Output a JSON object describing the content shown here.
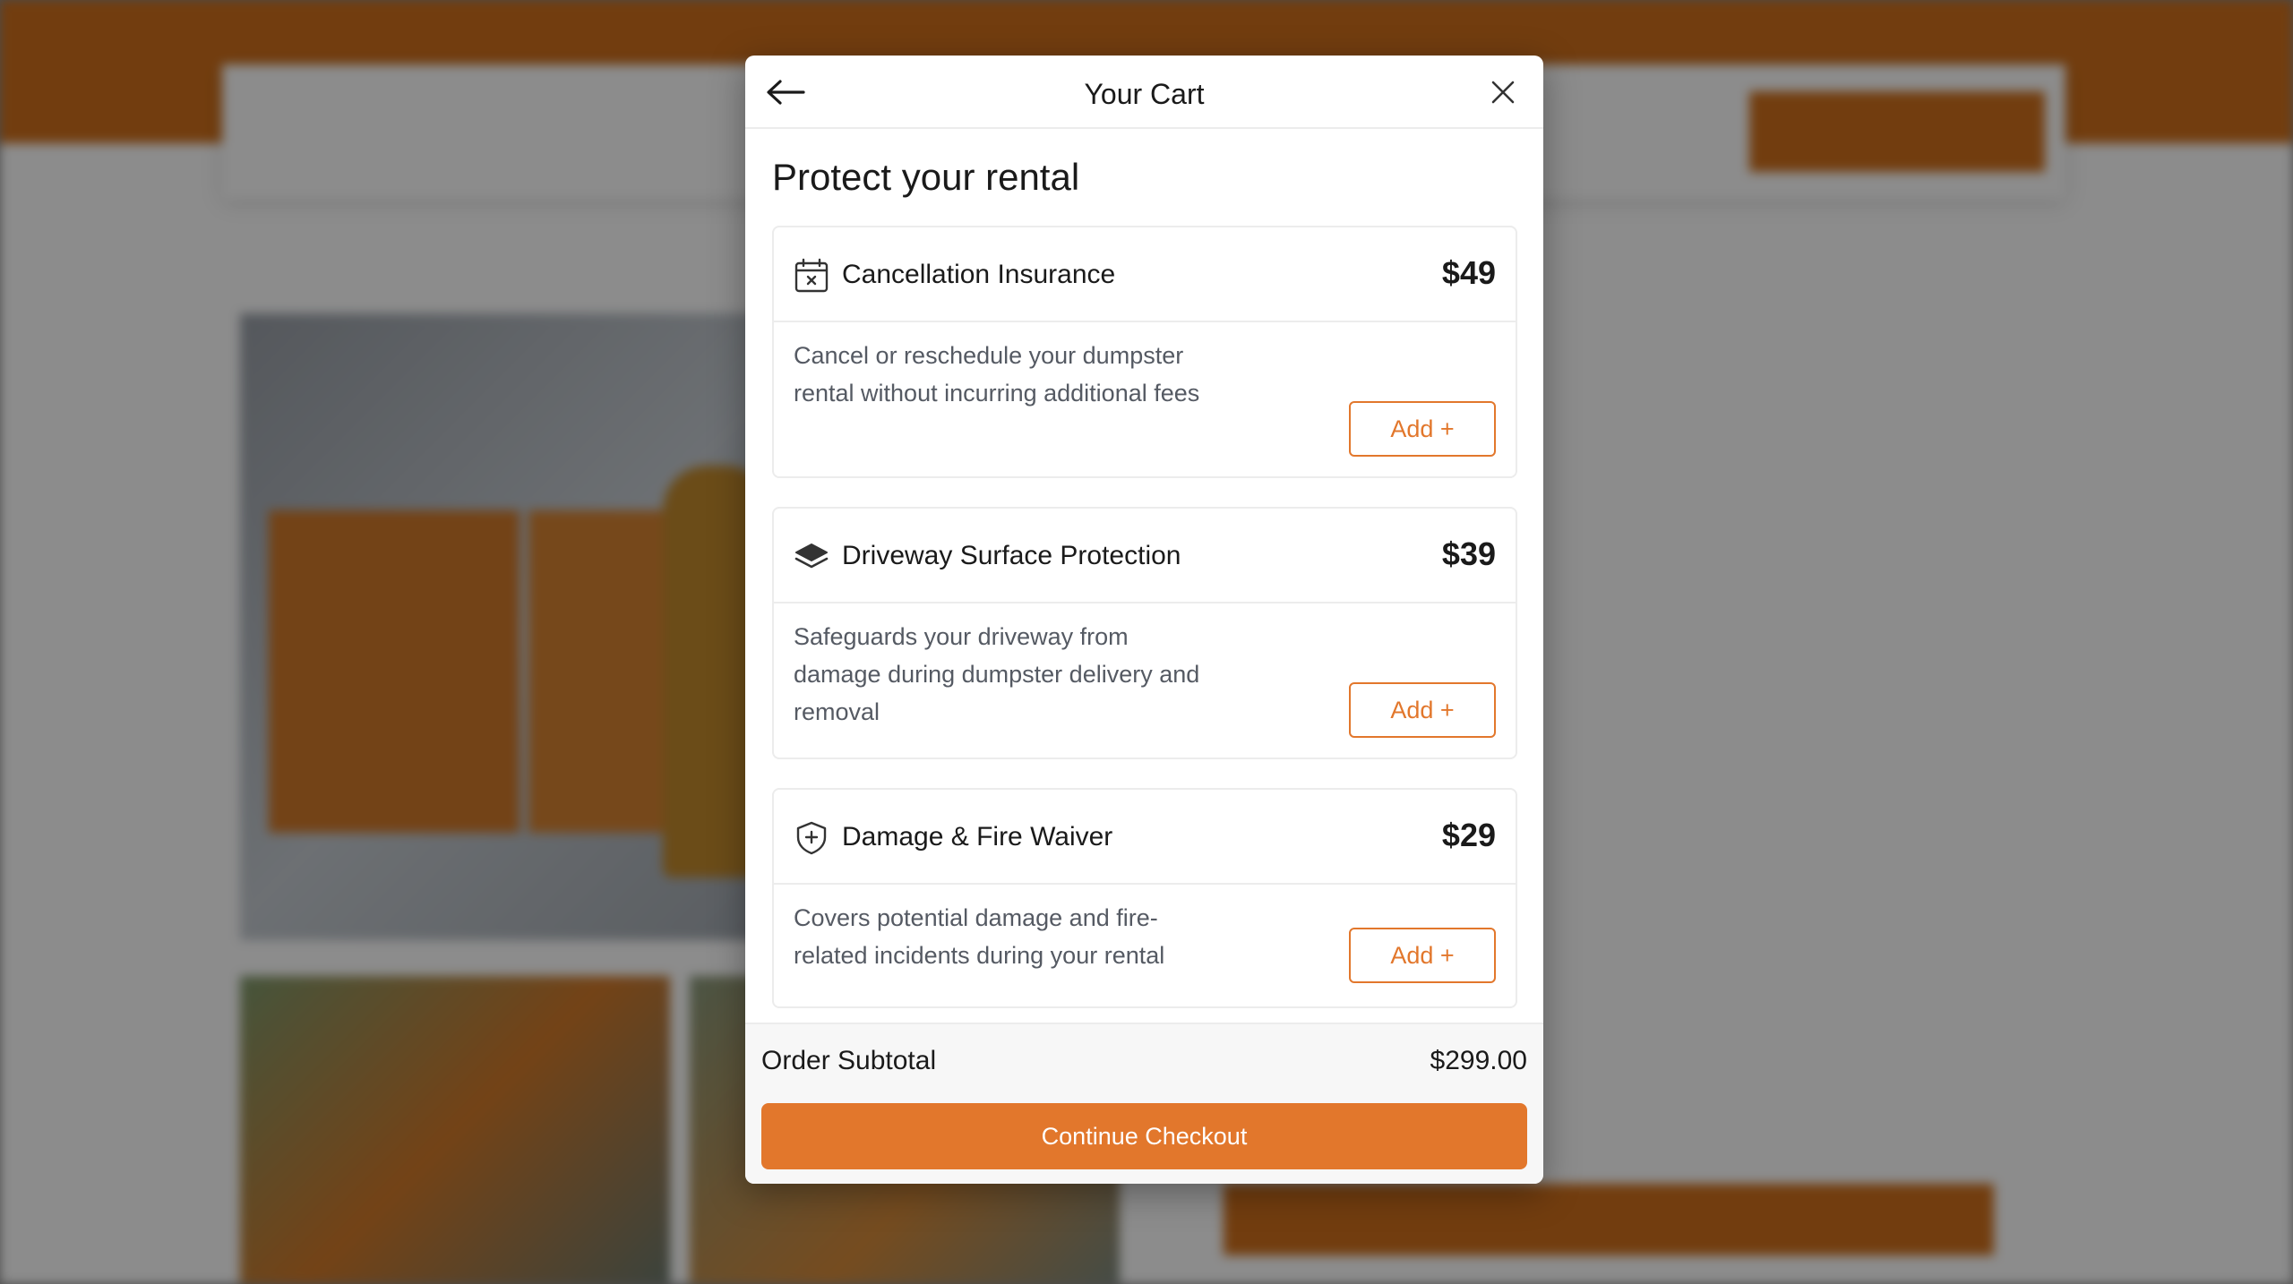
{
  "modal": {
    "title": "Your Cart",
    "section_heading": "Protect your rental",
    "addons": [
      {
        "name": "Cancellation Insurance",
        "price": "$49",
        "description": "Cancel or reschedule your dumpster rental without incurring additional fees",
        "button_label": "Add +",
        "icon": "calendar-x-icon"
      },
      {
        "name": "Driveway Surface Protection",
        "price": "$39",
        "description": "Safeguards your driveway from damage during dumpster delivery and removal",
        "button_label": "Add +",
        "icon": "layers-icon"
      },
      {
        "name": "Damage & Fire Waiver",
        "price": "$29",
        "description": "Covers potential damage and fire-related incidents during your rental",
        "button_label": "Add +",
        "icon": "shield-plus-icon"
      }
    ],
    "subtotal_label": "Order Subtotal",
    "subtotal_value": "$299.00",
    "checkout_label": "Continue Checkout"
  },
  "colors": {
    "accent": "#e2772c",
    "brand_blue": "#2b39c4",
    "topbar": "#d0701c"
  }
}
